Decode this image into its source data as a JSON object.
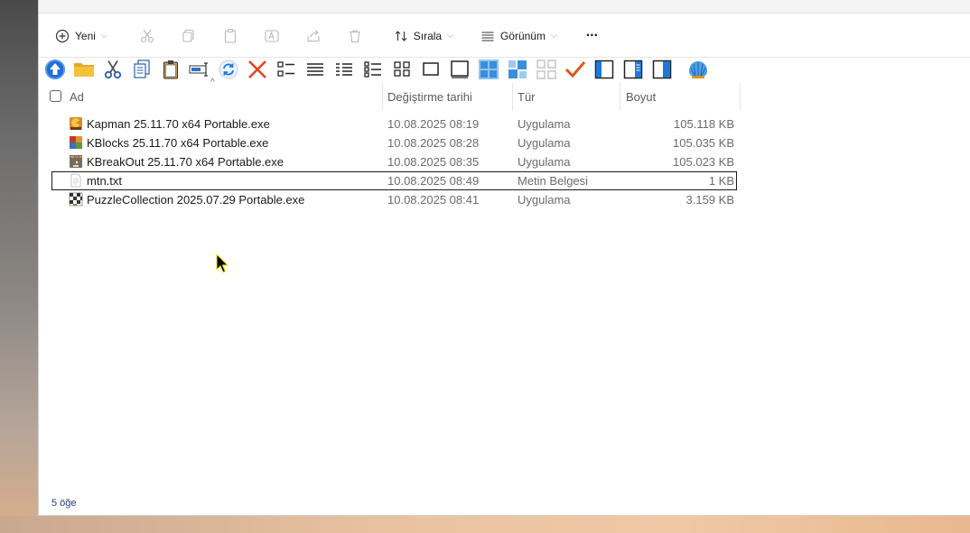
{
  "cmdbar": {
    "new_label": "Yeni",
    "sort_label": "Sırala",
    "view_label": "Görünüm",
    "more_label": "···"
  },
  "columns": {
    "name": "Ad",
    "date": "Değiştirme tarihi",
    "type": "Tür",
    "size": "Boyut"
  },
  "files": [
    {
      "name": "Kapman 25.11.70 x64 Portable.exe",
      "date": "10.08.2025 08:19",
      "type": "Uygulama",
      "size": "105.118 KB",
      "icon": "kapman-app-icon"
    },
    {
      "name": "KBlocks 25.11.70 x64 Portable.exe",
      "date": "10.08.2025 08:28",
      "type": "Uygulama",
      "size": "105.035 KB",
      "icon": "kblocks-app-icon"
    },
    {
      "name": "KBreakOut 25.11.70 x64 Portable.exe",
      "date": "10.08.2025 08:35",
      "type": "Uygulama",
      "size": "105.023 KB",
      "icon": "kbreakout-app-icon"
    },
    {
      "name": "mtn.txt",
      "date": "10.08.2025 08:49",
      "type": "Metin Belgesi",
      "size": "1 KB",
      "icon": "text-file-icon"
    },
    {
      "name": "PuzzleCollection 2025.07.29 Portable.exe",
      "date": "10.08.2025 08:41",
      "type": "Uygulama",
      "size": "3.159 KB",
      "icon": "puzzle-app-icon"
    }
  ],
  "status": {
    "count_text": "5 öğe"
  },
  "colors": {
    "accent_blue": "#1e6fd9",
    "delete_red": "#e0451f",
    "check_orange": "#e0561c",
    "folder_yellow": "#f3c23a"
  }
}
